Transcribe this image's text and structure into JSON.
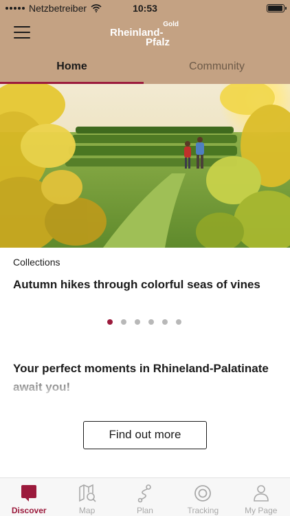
{
  "status_bar": {
    "carrier": "Netzbetreiber",
    "time": "10:53",
    "battery_level": 0.95
  },
  "header": {
    "logo_main": "Rheinland-",
    "logo_second": "Pfalz",
    "logo_badge": "Gold"
  },
  "tabs": [
    {
      "label": "Home",
      "active": true
    },
    {
      "label": "Community",
      "active": false
    }
  ],
  "feature": {
    "category": "Collections",
    "title": "Autumn hikes through colorful seas of vines",
    "page_count": 6,
    "active_page": 1
  },
  "promo": {
    "text": "Your perfect moments in Rhineland-Palatinate await you!",
    "button_label": "Find out more"
  },
  "bottom_nav": [
    {
      "label": "Discover",
      "icon": "discover-icon",
      "active": true
    },
    {
      "label": "Map",
      "icon": "map-icon",
      "active": false
    },
    {
      "label": "Plan",
      "icon": "plan-icon",
      "active": false
    },
    {
      "label": "Tracking",
      "icon": "tracking-icon",
      "active": false
    },
    {
      "label": "My Page",
      "icon": "profile-icon",
      "active": false
    }
  ],
  "colors": {
    "header_bg": "#c4a283",
    "accent": "#9b1a3c",
    "inactive": "#a8a8a8"
  }
}
